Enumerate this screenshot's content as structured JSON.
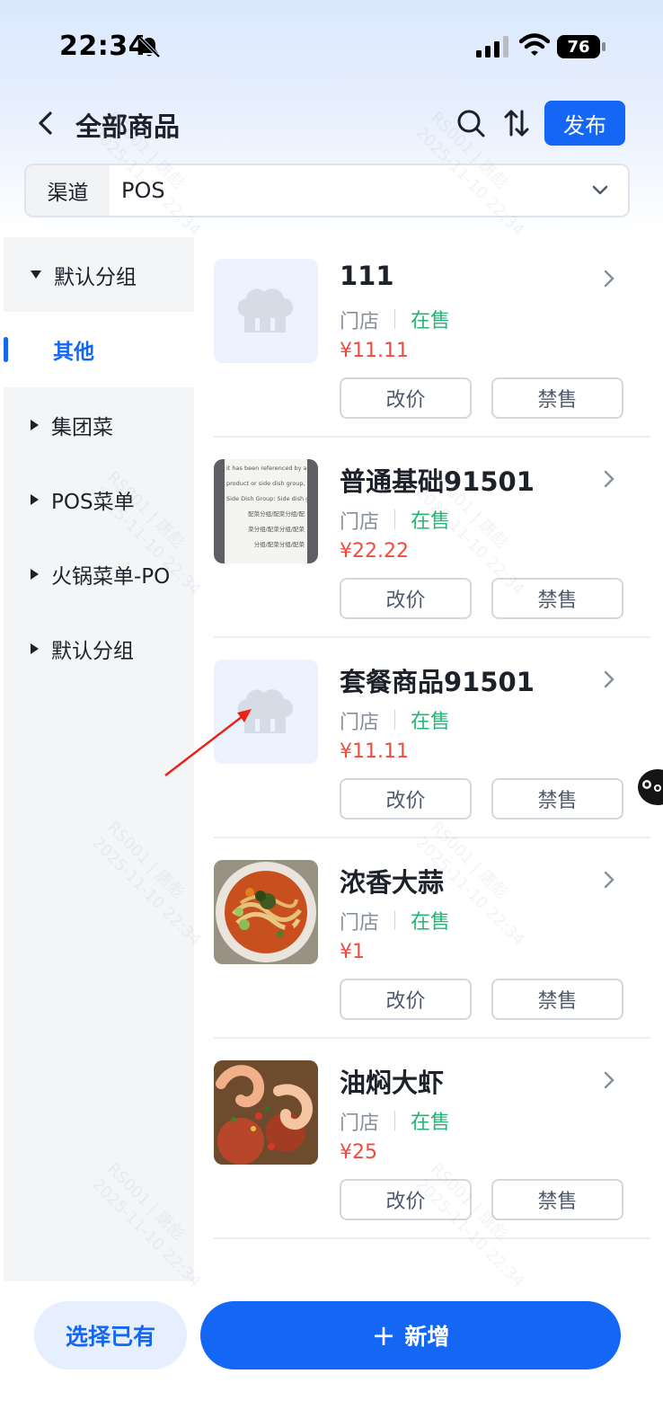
{
  "status_bar": {
    "time": "22:34",
    "battery": "76"
  },
  "nav": {
    "title": "全部商品",
    "publish_label": "发布"
  },
  "channel": {
    "label": "渠道",
    "value": "POS"
  },
  "sidebar": {
    "items": [
      {
        "label": "默认分组",
        "expanded": true
      },
      {
        "label": "其他",
        "active": true
      },
      {
        "label": "集团菜"
      },
      {
        "label": "POS菜单"
      },
      {
        "label": "火锅菜单-PO"
      },
      {
        "label": "默认分组"
      }
    ]
  },
  "products": [
    {
      "name": "111",
      "store": "门店",
      "status": "在售",
      "price": "¥11.11",
      "edit_price": "改价",
      "ban": "禁售",
      "image": "chef-hat-placeholder"
    },
    {
      "name": "普通基础91501",
      "store": "门店",
      "status": "在售",
      "price": "¥22.22",
      "edit_price": "改价",
      "ban": "禁售",
      "image": "document-photo",
      "image_text": [
        "it has been referenced by a combo",
        "product or side dish group, as follows",
        "Side Dish Group: Side dish grouping 2",
        "配菜分组/配菜分组/配",
        "菜分组/配菜分组/配菜",
        "分组/配菜分组/配菜"
      ]
    },
    {
      "name": "套餐商品91501",
      "store": "门店",
      "status": "在售",
      "price": "¥11.11",
      "edit_price": "改价",
      "ban": "禁售",
      "image": "chef-hat-placeholder"
    },
    {
      "name": "浓香大蒜",
      "store": "门店",
      "status": "在售",
      "price": "¥1",
      "edit_price": "改价",
      "ban": "禁售",
      "image": "noodle-bowl-photo"
    },
    {
      "name": "油焖大虾",
      "store": "门店",
      "status": "在售",
      "price": "¥25",
      "edit_price": "改价",
      "ban": "禁售",
      "image": "shrimp-dish-photo"
    }
  ],
  "bottom": {
    "select_existing": "选择已有",
    "add_new": "新增",
    "add_icon": "+"
  },
  "watermark": {
    "line1": "RS001 | 唐彪",
    "line2": "2025-11-10 22:34"
  },
  "colors": {
    "primary": "#1466f5",
    "on_sale": "#22b573",
    "price": "#f04b3f",
    "sidebar_bg": "#f3f5f7"
  },
  "icons": [
    "back-icon",
    "search-icon",
    "sort-icon",
    "chevron-down-icon",
    "chevron-right-icon",
    "chef-hat-icon",
    "bell-slash-icon",
    "signal-icon",
    "wifi-icon",
    "battery-icon"
  ]
}
